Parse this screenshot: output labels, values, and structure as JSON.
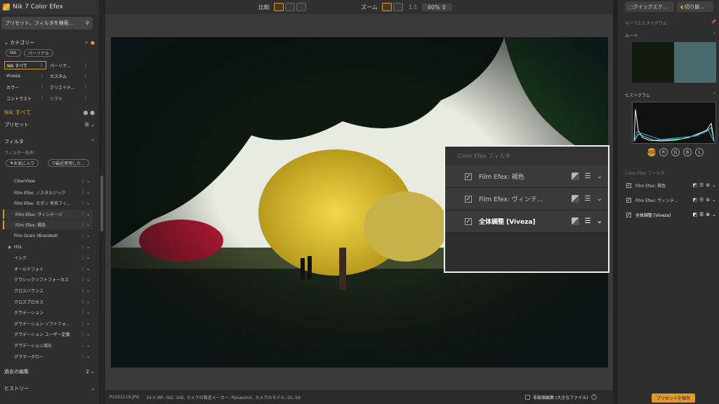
{
  "app": {
    "title": "Nik 7 Color Efex"
  },
  "search": {
    "placeholder": "プリセット、フィルタを検索..."
  },
  "category": {
    "header": "カテゴリー",
    "chips": [
      "Nik",
      "パーソナル"
    ],
    "items": [
      "Nik すべて",
      "パーソナ...",
      "Viveza",
      "カスタム",
      "カラー",
      "クリエイテ...",
      "コントラスト",
      "ソフト"
    ]
  },
  "current": "Nik すべて",
  "presets": "プリセット",
  "filters": {
    "header": "フィルタ",
    "condition": "フィルター条件:",
    "fav": "お気に入り",
    "recent": "最近使用した...",
    "items": [
      "ClearView",
      "Film Efex: ノスタルジック",
      "Film Efex: モダン 有名フィ...",
      "Film Efex: ヴィンテージ",
      "Film Efex: 褐色",
      "Film Grain (Branded)",
      "HSL",
      "インク",
      "オールドフォト",
      "クラシックソフトフォーカス",
      "クロスバランス",
      "クロスプロセス",
      "グラデーション",
      "グラデーション ソフトフォ...",
      "グラデーション ユーザー定義",
      "グラデーション減光",
      "グラマーグロー"
    ]
  },
  "history_edits": {
    "label": "過去の編集",
    "count": "2"
  },
  "history": "ヒストリー",
  "toolbar": {
    "compare": "比較",
    "zoom": "ズーム",
    "ratio": "1:1",
    "zoom_value": "40%"
  },
  "status": {
    "file": "P1022119.JPG",
    "info": "24.0 MP, ISO: 100, カメラの製造メーカー: Panasonic, カメラのモデル: DC-S9",
    "nondestructive": "非破壊編集 (大きなファイル)"
  },
  "popup": {
    "title": "Color Efex フィルタ",
    "rows": [
      "Film Efex: 褐色",
      "Film Efex: ヴィンテ...",
      "全体調整 [Viveza]"
    ]
  },
  "right": {
    "quick": "クイックエク...",
    "cut": "切り替...",
    "loupe_hist": "ルーペとヒストグラム",
    "loupe": "ルーペ",
    "histogram": "ヒストグラム",
    "channels": [
      "RGB",
      "R",
      "G",
      "B",
      "L"
    ],
    "filters_label": "Color Efex フィルタ",
    "rows": [
      "Film Efex: 褐色",
      "Film Efex: ヴィンテ...",
      "全体調整 [Viveza]"
    ],
    "save": "プリセットを保存"
  },
  "colors": {
    "accent": "#e09a2a"
  }
}
